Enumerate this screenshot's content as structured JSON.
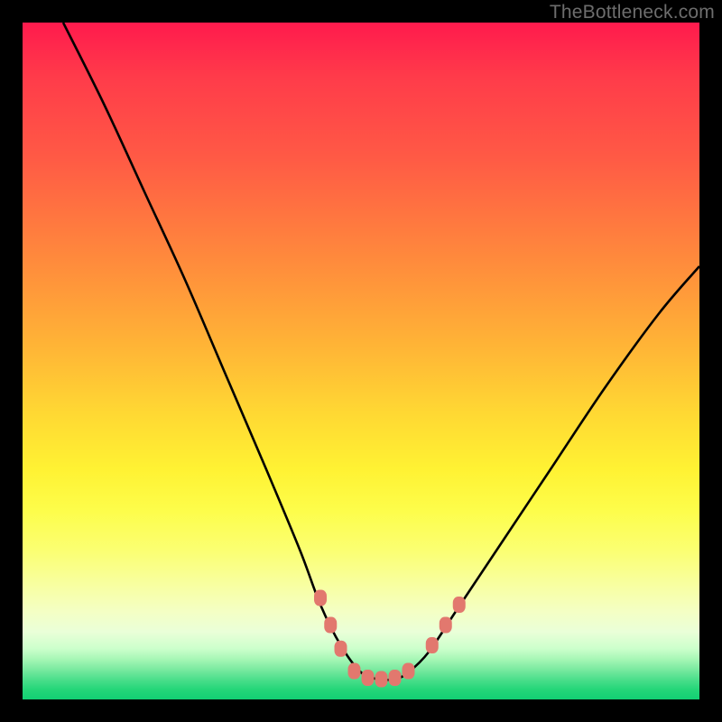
{
  "watermark_text": "TheBottleneck.com",
  "chart_data": {
    "type": "line",
    "title": "",
    "xlabel": "",
    "ylabel": "",
    "xlim": [
      0,
      100
    ],
    "ylim": [
      0,
      100
    ],
    "gradient_note": "vertical color gradient from red (top, high bottleneck) through orange/yellow to green (bottom, optimal)",
    "series": [
      {
        "name": "bottleneck-curve",
        "x": [
          6,
          12,
          18,
          24,
          30,
          36,
          41,
          44,
          47,
          50,
          52.5,
          55,
          57,
          60,
          64,
          70,
          78,
          86,
          94,
          100
        ],
        "y": [
          100,
          88,
          75,
          62,
          48,
          34,
          22,
          14,
          8,
          4,
          3,
          3,
          4,
          7,
          13,
          22,
          34,
          46,
          57,
          64
        ]
      }
    ],
    "markers": [
      {
        "name": "left-marker-1",
        "x": 44,
        "y": 15
      },
      {
        "name": "left-marker-2",
        "x": 45.5,
        "y": 11
      },
      {
        "name": "left-marker-3",
        "x": 47,
        "y": 7.5
      },
      {
        "name": "bottom-marker-1",
        "x": 49,
        "y": 4.2
      },
      {
        "name": "bottom-marker-2",
        "x": 51,
        "y": 3.2
      },
      {
        "name": "bottom-marker-3",
        "x": 53,
        "y": 3
      },
      {
        "name": "bottom-marker-4",
        "x": 55,
        "y": 3.2
      },
      {
        "name": "bottom-marker-5",
        "x": 57,
        "y": 4.2
      },
      {
        "name": "right-marker-1",
        "x": 60.5,
        "y": 8
      },
      {
        "name": "right-marker-2",
        "x": 62.5,
        "y": 11
      },
      {
        "name": "right-marker-3",
        "x": 64.5,
        "y": 14
      }
    ],
    "marker_color": "#e2786e",
    "curve_color": "#000000"
  }
}
